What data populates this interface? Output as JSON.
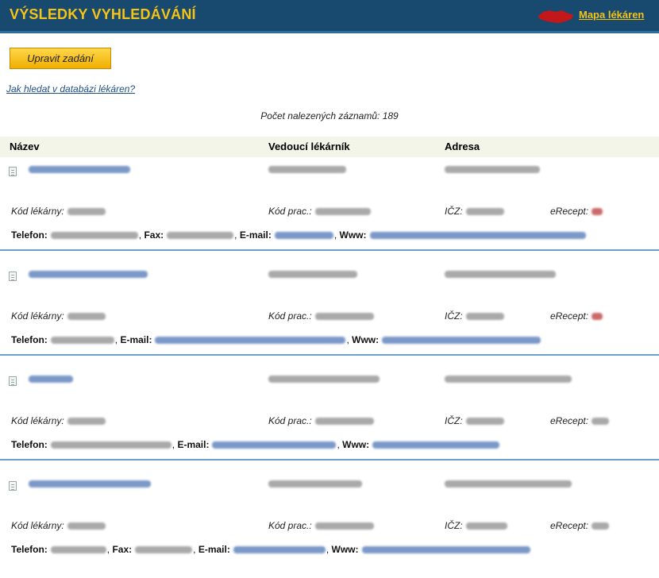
{
  "header": {
    "title": "VÝSLEDKY VYHLEDÁVÁNÍ",
    "map_link": "Mapa lékáren",
    "map_icon": "czech-map-icon",
    "colors": {
      "background": "#174a6e",
      "accent": "#f6c316"
    }
  },
  "edit_button": "Upravit zadání",
  "help_link": "Jak hledat v databázi lékáren?",
  "count": {
    "label": "Počet nalezených záznamů:",
    "value": "189"
  },
  "columns": {
    "name": "Název",
    "pharmacist": "Vedoucí lékárník",
    "address": "Adresa"
  },
  "labels": {
    "kod_lekarny": "Kód lékárny:",
    "kod_prac": "Kód prac.:",
    "icz": "IČZ:",
    "erecept": "eRecept:",
    "telefon": "Telefon:",
    "fax": "Fax:",
    "email": "E-mail:",
    "www": "Www:"
  },
  "records": [
    {
      "name": "",
      "pharmacist": "",
      "address": "",
      "kod_lekarny": "",
      "kod_prac": "",
      "icz": "",
      "erecept": "",
      "telefon": "",
      "fax": "",
      "email": "",
      "www": ""
    },
    {
      "name": "",
      "pharmacist": "",
      "address": "",
      "kod_lekarny": "",
      "kod_prac": "",
      "icz": "",
      "erecept": "",
      "telefon": "",
      "email": "",
      "www": ""
    },
    {
      "name": "",
      "pharmacist": "",
      "address": "",
      "kod_lekarny": "",
      "kod_prac": "",
      "icz": "",
      "erecept": "",
      "telefon": "",
      "email": "",
      "www": ""
    },
    {
      "name": "",
      "pharmacist": "",
      "address": "",
      "kod_lekarny": "",
      "kod_prac": "",
      "icz": "",
      "erecept": "",
      "telefon": "",
      "fax": "",
      "email": "",
      "www": ""
    }
  ]
}
